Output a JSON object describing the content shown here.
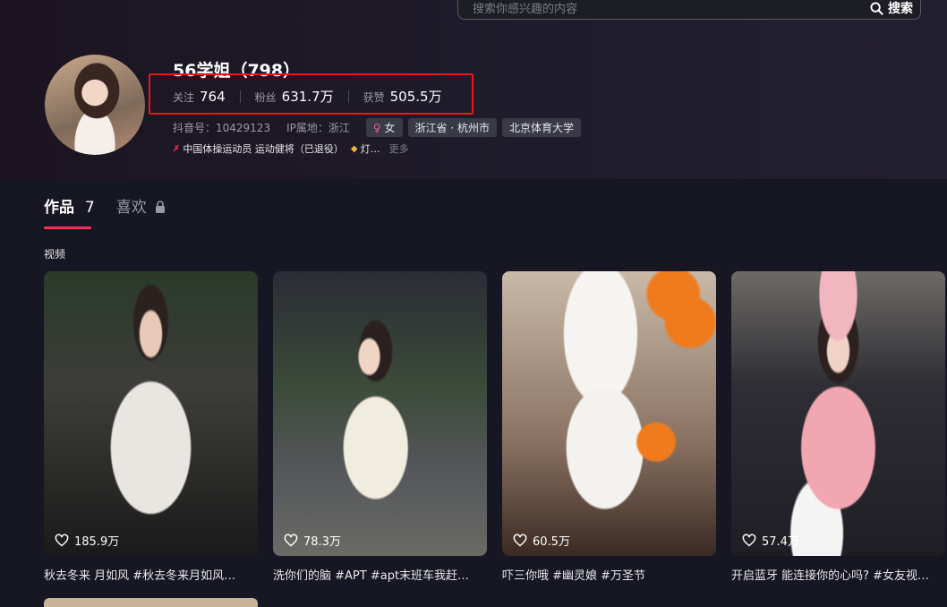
{
  "search": {
    "placeholder": "搜索你感兴趣的内容",
    "button_label": "搜索"
  },
  "profile": {
    "name": "56学姐（798）",
    "stats": [
      {
        "label": "关注",
        "value": "764"
      },
      {
        "label": "粉丝",
        "value": "631.7万"
      },
      {
        "label": "获赞",
        "value": "505.5万"
      }
    ],
    "douyin_id": "抖音号：10429123",
    "ip_location": "IP属地：浙江",
    "tags": [
      "女",
      "浙江省 · 杭州市",
      "北京体育大学"
    ],
    "bio": "中国体操运动员 运动健将（已退役）",
    "bio_extra": "灯…",
    "more_label": "更多"
  },
  "tabs": [
    {
      "label": "作品",
      "count": "7"
    },
    {
      "label": "喜欢"
    }
  ],
  "section_title": "视频",
  "videos": [
    {
      "likes": "185.9万",
      "caption": "秋去冬来 月如风 #秋去冬来月如风…"
    },
    {
      "likes": "78.3万",
      "caption": "洗你们的脑 #APT #apt末班车我赶…"
    },
    {
      "likes": "60.5万",
      "caption": "吓三你哦 #幽灵娘 #万圣节"
    },
    {
      "likes": "57.4万",
      "caption": "开启蓝牙 能连接你的心吗? #女友视…"
    }
  ],
  "colors": {
    "accent": "#fe2c55",
    "highlight_box": "#e21b1b",
    "background": "#161722"
  },
  "icons": [
    "search-icon",
    "heart-icon",
    "lock-icon",
    "female-icon",
    "gymnast-icon",
    "tag-icon"
  ]
}
